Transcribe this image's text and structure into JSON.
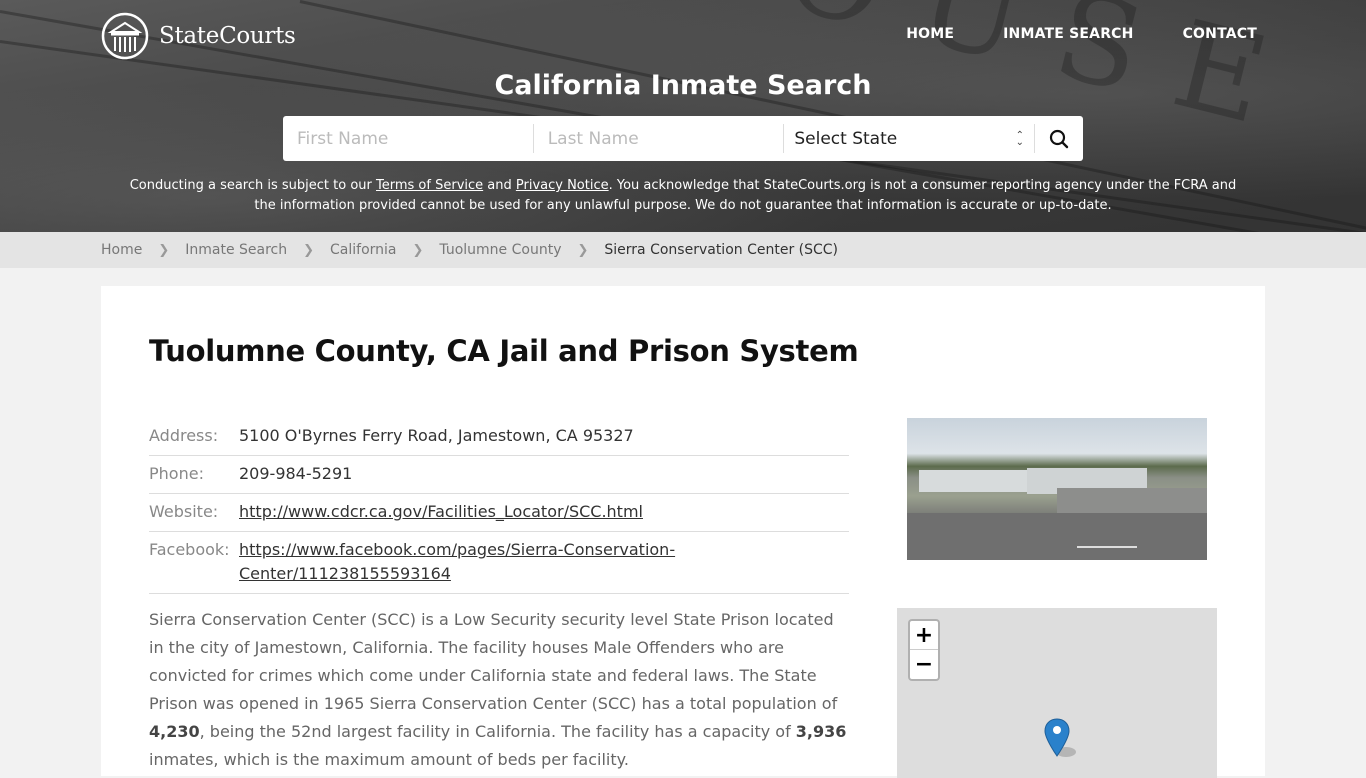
{
  "header": {
    "logo_text": "StateCourts",
    "nav": [
      {
        "label": "HOME"
      },
      {
        "label": "INMATE SEARCH"
      },
      {
        "label": "CONTACT"
      }
    ],
    "hero_title": "California Inmate Search",
    "search": {
      "first_name_placeholder": "First Name",
      "last_name_placeholder": "Last Name",
      "state_selected": "Select State"
    },
    "disclaimer": {
      "part1": "Conducting a search is subject to our ",
      "terms_link": "Terms of Service",
      "part2": " and ",
      "privacy_link": "Privacy Notice",
      "part3": ". You acknowledge that StateCourts.org is not a consumer reporting agency under the FCRA and the information provided cannot be used for any unlawful purpose. We do not guarantee that information is accurate or up-to-date."
    }
  },
  "breadcrumb": [
    {
      "label": "Home"
    },
    {
      "label": "Inmate Search"
    },
    {
      "label": "California"
    },
    {
      "label": "Tuolumne County"
    },
    {
      "label": "Sierra Conservation Center (SCC)"
    }
  ],
  "main": {
    "title": "Tuolumne County, CA Jail and Prison System",
    "info": [
      {
        "label": "Address:",
        "value": "5100 O'Byrnes Ferry Road, Jamestown, CA 95327"
      },
      {
        "label": "Phone:",
        "value": "209-984-5291"
      },
      {
        "label": "Website:",
        "value": "http://www.cdcr.ca.gov/Facilities_Locator/SCC.html"
      },
      {
        "label": "Facebook:",
        "value": "https://www.facebook.com/pages/Sierra-Conservation-Center/111238155593164"
      }
    ],
    "description": {
      "part1": "Sierra Conservation Center (SCC) is a Low Security security level State Prison located in the city of Jamestown, California. The facility houses Male Offenders who are convicted for crimes which come under California state and federal laws. The State Prison was opened in 1965 Sierra Conservation Center (SCC) has a total population of ",
      "population": "4,230",
      "part2": ", being the 52nd largest facility in California. The facility has a capacity of ",
      "capacity": "3,936",
      "part3": " inmates, which is the maximum amount of beds per facility."
    },
    "map": {
      "zoom_in": "+",
      "zoom_out": "−",
      "pin_color": "#2a81cb"
    }
  }
}
